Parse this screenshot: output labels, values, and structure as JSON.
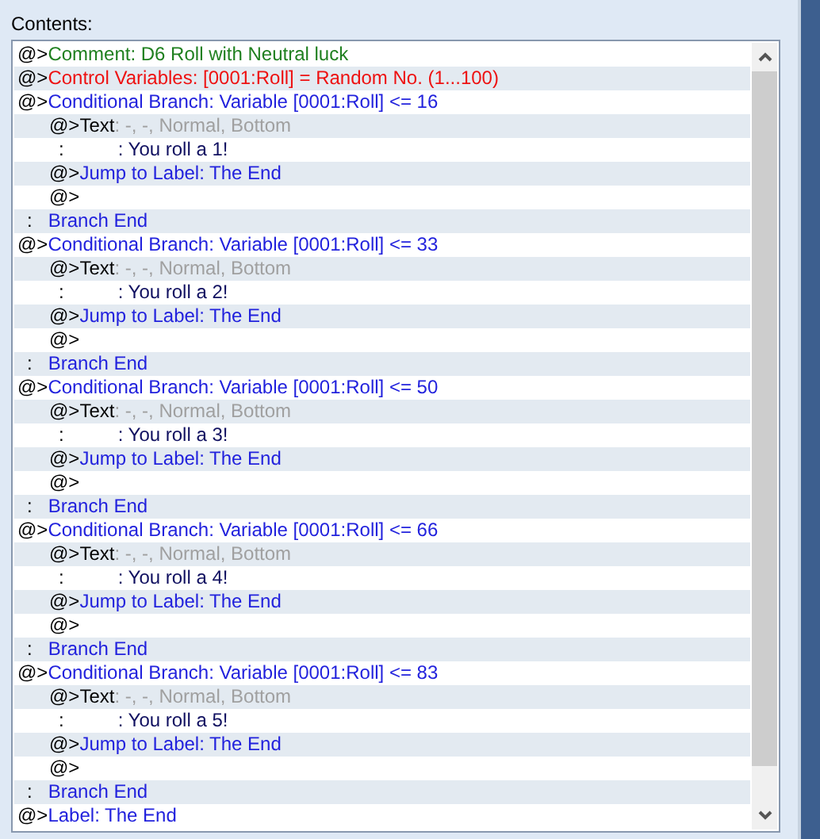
{
  "label": "Contents:",
  "lines": [
    {
      "kind": "command",
      "segments": [
        {
          "text": "@>",
          "color": "#000000"
        },
        {
          "text": "Comment: D6 Roll with Neutral luck",
          "color": "#208020"
        }
      ]
    },
    {
      "kind": "command",
      "segments": [
        {
          "text": "@>",
          "color": "#000000"
        },
        {
          "text": "Control Variables: [0001:Roll] = Random No. (1...100)",
          "color": "#ee1111"
        }
      ]
    },
    {
      "kind": "command",
      "segments": [
        {
          "text": "@>",
          "color": "#000000"
        },
        {
          "text": "Conditional Branch: Variable [0001:Roll] <= 16",
          "color": "#2222dd"
        }
      ],
      "children": [
        {
          "kind": "command",
          "segments": [
            {
              "text": "@>Text",
              "color": "#000000"
            },
            {
              "text": ": -, -, Normal, Bottom",
              "color": "#a0a0a0"
            }
          ]
        },
        {
          "kind": "message",
          "segments": [
            {
              "text": ":",
              "color": "#000000"
            },
            {
              "text": ": You roll a 1!",
              "color": "#101060"
            }
          ]
        },
        {
          "kind": "command",
          "segments": [
            {
              "text": "@>",
              "color": "#000000"
            },
            {
              "text": "Jump to Label: The End",
              "color": "#2222dd"
            }
          ]
        },
        {
          "kind": "command",
          "segments": [
            {
              "text": "@>",
              "color": "#000000"
            }
          ]
        }
      ]
    },
    {
      "kind": "end",
      "segments": [
        {
          "text": ":",
          "color": "#000000"
        },
        {
          "text": "Branch End",
          "color": "#2222dd"
        }
      ]
    },
    {
      "kind": "command",
      "segments": [
        {
          "text": "@>",
          "color": "#000000"
        },
        {
          "text": "Conditional Branch: Variable [0001:Roll] <= 33",
          "color": "#2222dd"
        }
      ],
      "children": [
        {
          "kind": "command",
          "segments": [
            {
              "text": "@>Text",
              "color": "#000000"
            },
            {
              "text": ": -, -, Normal, Bottom",
              "color": "#a0a0a0"
            }
          ]
        },
        {
          "kind": "message",
          "segments": [
            {
              "text": ":",
              "color": "#000000"
            },
            {
              "text": ": You roll a 2!",
              "color": "#101060"
            }
          ]
        },
        {
          "kind": "command",
          "segments": [
            {
              "text": "@>",
              "color": "#000000"
            },
            {
              "text": "Jump to Label: The End",
              "color": "#2222dd"
            }
          ]
        },
        {
          "kind": "command",
          "segments": [
            {
              "text": "@>",
              "color": "#000000"
            }
          ]
        }
      ]
    },
    {
      "kind": "end",
      "segments": [
        {
          "text": ":",
          "color": "#000000"
        },
        {
          "text": "Branch End",
          "color": "#2222dd"
        }
      ]
    },
    {
      "kind": "command",
      "segments": [
        {
          "text": "@>",
          "color": "#000000"
        },
        {
          "text": "Conditional Branch: Variable [0001:Roll] <= 50",
          "color": "#2222dd"
        }
      ],
      "children": [
        {
          "kind": "command",
          "segments": [
            {
              "text": "@>Text",
              "color": "#000000"
            },
            {
              "text": ": -, -, Normal, Bottom",
              "color": "#a0a0a0"
            }
          ]
        },
        {
          "kind": "message",
          "segments": [
            {
              "text": ":",
              "color": "#000000"
            },
            {
              "text": ": You roll a 3!",
              "color": "#101060"
            }
          ]
        },
        {
          "kind": "command",
          "segments": [
            {
              "text": "@>",
              "color": "#000000"
            },
            {
              "text": "Jump to Label: The End",
              "color": "#2222dd"
            }
          ]
        },
        {
          "kind": "command",
          "segments": [
            {
              "text": "@>",
              "color": "#000000"
            }
          ]
        }
      ]
    },
    {
      "kind": "end",
      "segments": [
        {
          "text": ":",
          "color": "#000000"
        },
        {
          "text": "Branch End",
          "color": "#2222dd"
        }
      ]
    },
    {
      "kind": "command",
      "segments": [
        {
          "text": "@>",
          "color": "#000000"
        },
        {
          "text": "Conditional Branch: Variable [0001:Roll] <= 66",
          "color": "#2222dd"
        }
      ],
      "children": [
        {
          "kind": "command",
          "segments": [
            {
              "text": "@>Text",
              "color": "#000000"
            },
            {
              "text": ": -, -, Normal, Bottom",
              "color": "#a0a0a0"
            }
          ]
        },
        {
          "kind": "message",
          "segments": [
            {
              "text": ":",
              "color": "#000000"
            },
            {
              "text": ": You roll a 4!",
              "color": "#101060"
            }
          ]
        },
        {
          "kind": "command",
          "segments": [
            {
              "text": "@>",
              "color": "#000000"
            },
            {
              "text": "Jump to Label: The End",
              "color": "#2222dd"
            }
          ]
        },
        {
          "kind": "command",
          "segments": [
            {
              "text": "@>",
              "color": "#000000"
            }
          ]
        }
      ]
    },
    {
      "kind": "end",
      "segments": [
        {
          "text": ":",
          "color": "#000000"
        },
        {
          "text": "Branch End",
          "color": "#2222dd"
        }
      ]
    },
    {
      "kind": "command",
      "segments": [
        {
          "text": "@>",
          "color": "#000000"
        },
        {
          "text": "Conditional Branch: Variable [0001:Roll] <= 83",
          "color": "#2222dd"
        }
      ],
      "children": [
        {
          "kind": "command",
          "segments": [
            {
              "text": "@>Text",
              "color": "#000000"
            },
            {
              "text": ": -, -, Normal, Bottom",
              "color": "#a0a0a0"
            }
          ]
        },
        {
          "kind": "message",
          "segments": [
            {
              "text": ":",
              "color": "#000000"
            },
            {
              "text": ": You roll a 5!",
              "color": "#101060"
            }
          ]
        },
        {
          "kind": "command",
          "segments": [
            {
              "text": "@>",
              "color": "#000000"
            },
            {
              "text": "Jump to Label: The End",
              "color": "#2222dd"
            }
          ]
        },
        {
          "kind": "command",
          "segments": [
            {
              "text": "@>",
              "color": "#000000"
            }
          ]
        }
      ]
    },
    {
      "kind": "end",
      "segments": [
        {
          "text": ":",
          "color": "#000000"
        },
        {
          "text": "Branch End",
          "color": "#2222dd"
        }
      ]
    },
    {
      "kind": "command",
      "segments": [
        {
          "text": "@>",
          "color": "#000000"
        },
        {
          "text": "Label: The End",
          "color": "#2222dd"
        }
      ]
    }
  ]
}
